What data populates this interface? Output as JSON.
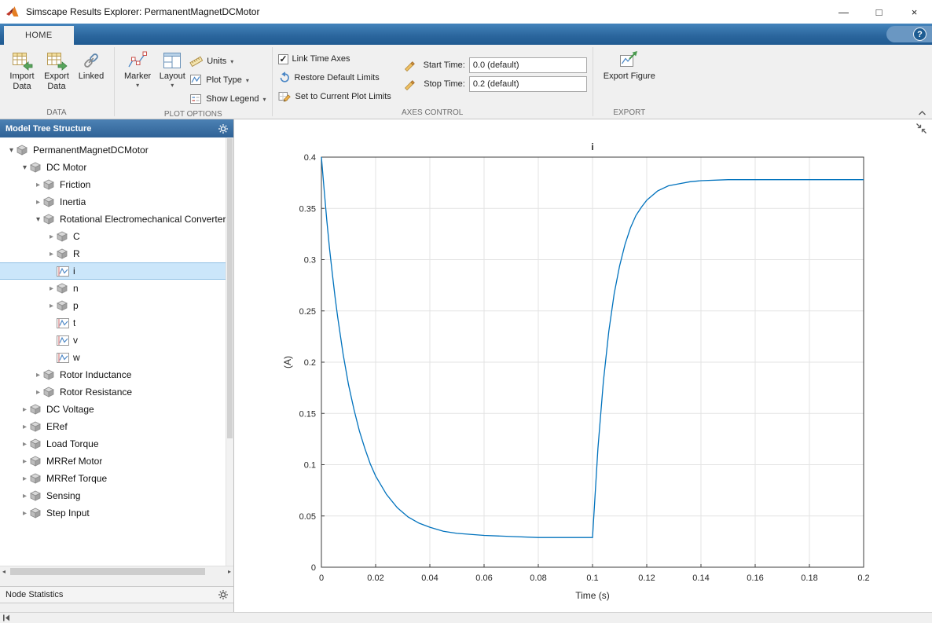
{
  "window": {
    "title": "Simscape Results Explorer: PermanentMagnetDCMotor",
    "minimize": "—",
    "maximize": "□",
    "close": "×"
  },
  "tabstrip": {
    "home_tab": "HOME",
    "help_label": "?"
  },
  "icons": {
    "dropdown_arrow": "▾",
    "scroll_left": "◂",
    "scroll_right": "▸",
    "tree_expanded": "▾",
    "tree_collapsed": "▸"
  },
  "ribbon": {
    "data_group": {
      "label": "DATA",
      "import_line1": "Import",
      "import_line2": "Data",
      "export_line1": "Export",
      "export_line2": "Data",
      "linked_label": "Linked"
    },
    "plot_options_group": {
      "label": "PLOT OPTIONS",
      "marker_label": "Marker",
      "layout_label": "Layout",
      "units_label": "Units",
      "plot_type_label": "Plot Type",
      "show_legend_label": "Show Legend"
    },
    "axes_control_group": {
      "label": "AXES CONTROL",
      "link_time_axes_label": "Link Time Axes",
      "link_time_axes_checked": true,
      "restore_label": "Restore Default Limits",
      "set_limits_label": "Set to Current Plot Limits",
      "start_time_label": "Start Time:",
      "start_time_value": "0.0 (default)",
      "stop_time_label": "Stop Time:",
      "stop_time_value": "0.2 (default)"
    },
    "export_group": {
      "label": "EXPORT",
      "export_figure_label": "Export Figure"
    }
  },
  "left_panel": {
    "header_title": "Model Tree Structure",
    "node_statistics_label": "Node Statistics",
    "tree": [
      {
        "label": "PermanentMagnetDCMotor",
        "level": 0,
        "state": "expanded",
        "icon": "block",
        "selected": false
      },
      {
        "label": "DC Motor",
        "level": 1,
        "state": "expanded",
        "icon": "block",
        "selected": false
      },
      {
        "label": "Friction",
        "level": 2,
        "state": "collapsed",
        "icon": "block",
        "selected": false
      },
      {
        "label": "Inertia",
        "level": 2,
        "state": "collapsed",
        "icon": "block",
        "selected": false
      },
      {
        "label": "Rotational Electromechanical Converter",
        "level": 2,
        "state": "expanded",
        "icon": "block",
        "selected": false
      },
      {
        "label": "C",
        "level": 3,
        "state": "collapsed",
        "icon": "block",
        "selected": false
      },
      {
        "label": "R",
        "level": 3,
        "state": "collapsed",
        "icon": "block",
        "selected": false
      },
      {
        "label": "i",
        "level": 3,
        "state": "leaf",
        "icon": "signal",
        "selected": true
      },
      {
        "label": "n",
        "level": 3,
        "state": "collapsed",
        "icon": "block",
        "selected": false
      },
      {
        "label": "p",
        "level": 3,
        "state": "collapsed",
        "icon": "block",
        "selected": false
      },
      {
        "label": "t",
        "level": 3,
        "state": "leaf",
        "icon": "signal",
        "selected": false
      },
      {
        "label": "v",
        "level": 3,
        "state": "leaf",
        "icon": "signal",
        "selected": false
      },
      {
        "label": "w",
        "level": 3,
        "state": "leaf",
        "icon": "signal",
        "selected": false
      },
      {
        "label": "Rotor Inductance",
        "level": 2,
        "state": "collapsed",
        "icon": "block",
        "selected": false
      },
      {
        "label": "Rotor Resistance",
        "level": 2,
        "state": "collapsed",
        "icon": "block",
        "selected": false
      },
      {
        "label": "DC Voltage",
        "level": 1,
        "state": "collapsed",
        "icon": "block",
        "selected": false
      },
      {
        "label": "ERef",
        "level": 1,
        "state": "collapsed",
        "icon": "block",
        "selected": false
      },
      {
        "label": "Load Torque",
        "level": 1,
        "state": "collapsed",
        "icon": "block",
        "selected": false
      },
      {
        "label": "MRRef Motor",
        "level": 1,
        "state": "collapsed",
        "icon": "block",
        "selected": false
      },
      {
        "label": "MRRef Torque",
        "level": 1,
        "state": "collapsed",
        "icon": "block",
        "selected": false
      },
      {
        "label": "Sensing",
        "level": 1,
        "state": "collapsed",
        "icon": "block",
        "selected": false
      },
      {
        "label": "Step Input",
        "level": 1,
        "state": "collapsed",
        "icon": "block",
        "selected": false
      }
    ]
  },
  "chart_data": {
    "type": "line",
    "title": "i",
    "xlabel": "Time (s)",
    "ylabel": "(A)",
    "xlim": [
      0,
      0.2
    ],
    "ylim": [
      0,
      0.4
    ],
    "xticks": [
      0,
      0.02,
      0.04,
      0.06,
      0.08,
      0.1,
      0.12,
      0.14,
      0.16,
      0.18,
      0.2
    ],
    "xtick_labels": [
      "0",
      "0.02",
      "0.04",
      "0.06",
      "0.08",
      "0.1",
      "0.12",
      "0.14",
      "0.16",
      "0.18",
      "0.2"
    ],
    "yticks": [
      0,
      0.05,
      0.1,
      0.15,
      0.2,
      0.25,
      0.3,
      0.35,
      0.4
    ],
    "ytick_labels": [
      "0",
      "0.05",
      "0.1",
      "0.15",
      "0.2",
      "0.25",
      "0.3",
      "0.35",
      "0.4"
    ],
    "grid": true,
    "legend": false,
    "line_color": "#0072BD",
    "series": [
      {
        "name": "i",
        "x": [
          0,
          0.001,
          0.002,
          0.003,
          0.004,
          0.005,
          0.006,
          0.008,
          0.01,
          0.012,
          0.014,
          0.016,
          0.018,
          0.02,
          0.024,
          0.028,
          0.032,
          0.036,
          0.04,
          0.045,
          0.05,
          0.06,
          0.07,
          0.08,
          0.09,
          0.1,
          0.102,
          0.104,
          0.106,
          0.108,
          0.11,
          0.112,
          0.114,
          0.116,
          0.118,
          0.12,
          0.124,
          0.128,
          0.132,
          0.136,
          0.14,
          0.15,
          0.16,
          0.18,
          0.2
        ],
        "y": [
          0.4,
          0.368,
          0.338,
          0.311,
          0.287,
          0.264,
          0.244,
          0.208,
          0.178,
          0.154,
          0.133,
          0.116,
          0.101,
          0.089,
          0.071,
          0.058,
          0.049,
          0.043,
          0.039,
          0.035,
          0.033,
          0.031,
          0.03,
          0.029,
          0.029,
          0.029,
          0.116,
          0.181,
          0.23,
          0.267,
          0.294,
          0.315,
          0.331,
          0.343,
          0.351,
          0.358,
          0.367,
          0.372,
          0.374,
          0.376,
          0.377,
          0.378,
          0.378,
          0.378,
          0.378
        ]
      }
    ]
  }
}
